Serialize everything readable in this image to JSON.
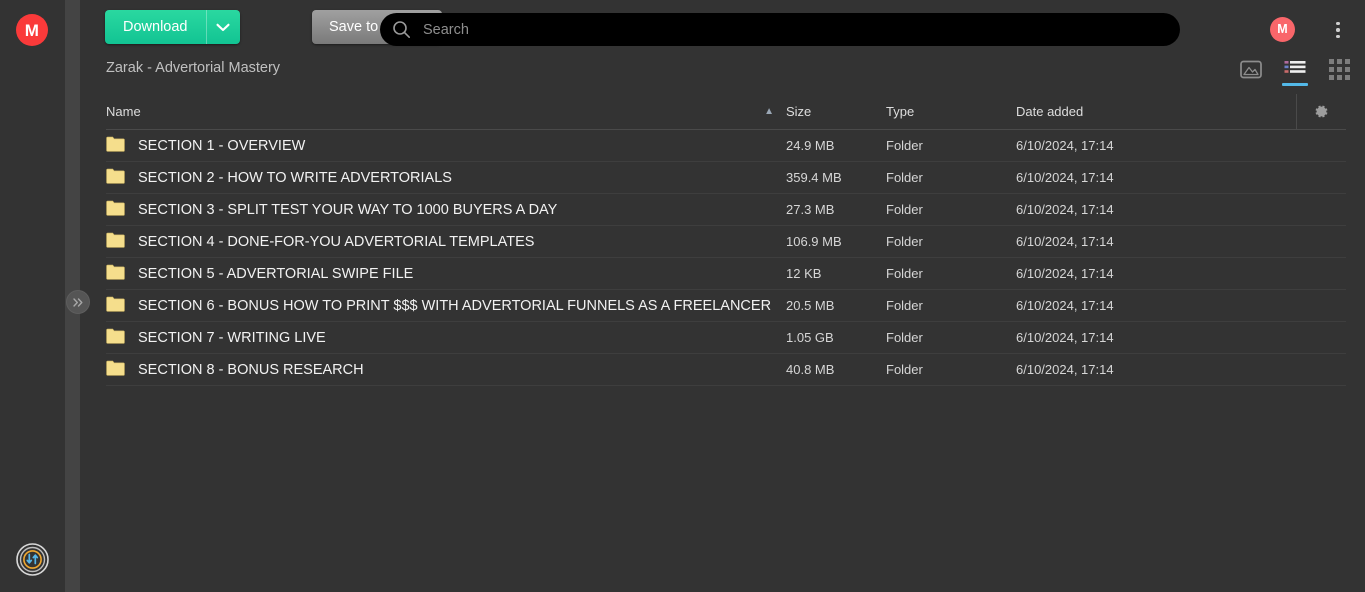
{
  "app": {
    "logo_letter": "M",
    "accent_green": "#12c493",
    "accent_red": "#fa3a3a",
    "accent_blue": "#53b9e8",
    "folder_color": "#f5de8c"
  },
  "toolbar": {
    "download_label": "Download",
    "download_caret_icon": "chevron-down-icon",
    "save_label": "Save to MEGA"
  },
  "search": {
    "placeholder": "Search",
    "value": "",
    "icon": "search-icon"
  },
  "account": {
    "avatar_letter": "M",
    "menu_icon": "kebab-menu-icon"
  },
  "breadcrumb": {
    "path": "Zarak - Advertorial Mastery"
  },
  "view_toggles": [
    {
      "name": "image-view-icon",
      "label": "Image view",
      "active": false
    },
    {
      "name": "list-view-icon",
      "label": "List view",
      "active": true
    },
    {
      "name": "grid-view-icon",
      "label": "Grid view",
      "active": false
    }
  ],
  "sidebar": {
    "collapse_handle_icon": "chevron-double-right-icon",
    "transfer_widget_icon": "transfer-arrows-icon"
  },
  "table": {
    "sort_column": "Name",
    "sort_direction": "ascending",
    "sort_icon": "chevron-up-icon",
    "settings_icon": "gear-icon",
    "columns": [
      {
        "key": "name",
        "label": "Name"
      },
      {
        "key": "size",
        "label": "Size"
      },
      {
        "key": "type",
        "label": "Type"
      },
      {
        "key": "date",
        "label": "Date added"
      }
    ],
    "rows": [
      {
        "icon": "folder-icon",
        "name": "SECTION 1 - OVERVIEW",
        "size": "24.9 MB",
        "type": "Folder",
        "date": "6/10/2024, 17:14"
      },
      {
        "icon": "folder-icon",
        "name": "SECTION 2 - HOW TO WRITE ADVERTORIALS",
        "size": "359.4 MB",
        "type": "Folder",
        "date": "6/10/2024, 17:14"
      },
      {
        "icon": "folder-icon",
        "name": "SECTION 3 - SPLIT TEST YOUR WAY TO 1000 BUYERS A DAY",
        "size": "27.3 MB",
        "type": "Folder",
        "date": "6/10/2024, 17:14"
      },
      {
        "icon": "folder-icon",
        "name": "SECTION 4 - DONE-FOR-YOU ADVERTORIAL TEMPLATES",
        "size": "106.9 MB",
        "type": "Folder",
        "date": "6/10/2024, 17:14"
      },
      {
        "icon": "folder-icon",
        "name": "SECTION 5 - ADVERTORIAL SWIPE FILE",
        "size": "12 KB",
        "type": "Folder",
        "date": "6/10/2024, 17:14"
      },
      {
        "icon": "folder-icon",
        "name": "SECTION 6 - BONUS HOW TO PRINT $$$ WITH ADVERTORIAL FUNNELS AS A FREELANCER",
        "size": "20.5 MB",
        "type": "Folder",
        "date": "6/10/2024, 17:14"
      },
      {
        "icon": "folder-icon",
        "name": "SECTION 7 - WRITING LIVE",
        "size": "1.05 GB",
        "type": "Folder",
        "date": "6/10/2024, 17:14"
      },
      {
        "icon": "folder-icon",
        "name": "SECTION 8 - BONUS RESEARCH",
        "size": "40.8 MB",
        "type": "Folder",
        "date": "6/10/2024, 17:14"
      }
    ]
  }
}
